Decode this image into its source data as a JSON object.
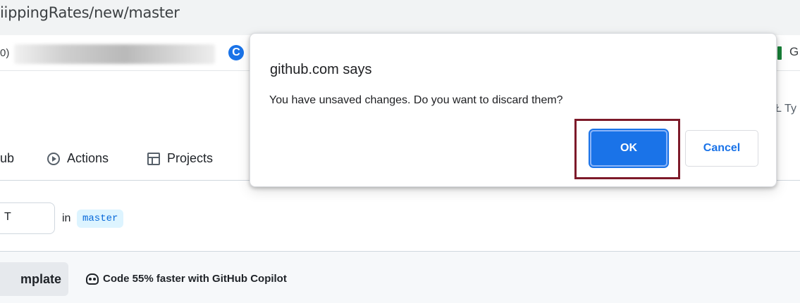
{
  "browser": {
    "url_fragment": "iippingRates/new/master",
    "bookmark_fragment": "0)",
    "bookmark_right_letter": "G",
    "search_fragment": "Ł Ty"
  },
  "repo_nav": {
    "partial_tab": "ub",
    "actions_label": "Actions",
    "projects_label": "Projects"
  },
  "editor": {
    "filename_fragment": "T",
    "in_label": "in",
    "branch": "master",
    "template_button": "mplate",
    "copilot_promo": "Code 55% faster with GitHub Copilot"
  },
  "dialog": {
    "title": "github.com says",
    "message": "You have unsaved changes. Do you want to discard them?",
    "ok_label": "OK",
    "cancel_label": "Cancel"
  },
  "colors": {
    "primary_button": "#1a73e8",
    "highlight_border": "#7d1a2a",
    "branch_pill_bg": "#ddf4ff"
  }
}
